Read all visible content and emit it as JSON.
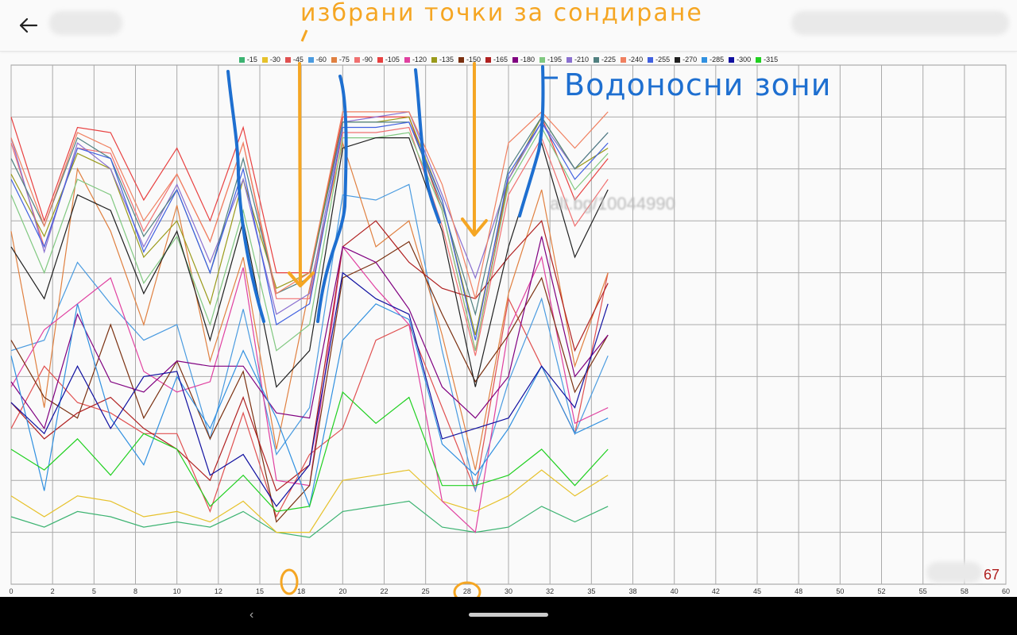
{
  "header": {
    "back_icon": "arrow-left-icon"
  },
  "chart_data": {
    "type": "line",
    "xlim": [
      0,
      60
    ],
    "x_ticks": [
      0,
      2,
      5,
      8,
      10,
      12,
      15,
      18,
      20,
      22,
      25,
      28,
      30,
      32,
      35,
      38,
      40,
      42,
      45,
      48,
      50,
      52,
      55,
      58,
      60
    ],
    "grid": true,
    "legend_position": "top-center",
    "x": [
      0,
      2,
      4,
      6,
      8,
      10,
      12,
      14,
      16,
      18,
      20,
      22,
      24,
      26,
      28,
      30,
      32,
      34,
      36
    ],
    "series": [
      {
        "name": "-15",
        "color": "#3cb371",
        "values": [
          0.87,
          0.89,
          0.86,
          0.87,
          0.89,
          0.88,
          0.89,
          0.86,
          0.9,
          0.91,
          0.86,
          0.85,
          0.84,
          0.89,
          0.9,
          0.89,
          0.85,
          0.88,
          0.85
        ]
      },
      {
        "name": "-30",
        "color": "#e6c12a",
        "values": [
          0.83,
          0.87,
          0.83,
          0.84,
          0.87,
          0.86,
          0.88,
          0.84,
          0.9,
          0.9,
          0.8,
          0.79,
          0.78,
          0.84,
          0.86,
          0.83,
          0.78,
          0.83,
          0.79
        ]
      },
      {
        "name": "-45",
        "color": "#e05050",
        "values": [
          0.7,
          0.58,
          0.65,
          0.67,
          0.71,
          0.71,
          0.86,
          0.67,
          0.87,
          0.75,
          0.7,
          0.53,
          0.5,
          0.66,
          0.82,
          0.45,
          0.58,
          0.71,
          0.4
        ]
      },
      {
        "name": "-60",
        "color": "#4a9be0",
        "values": [
          0.55,
          0.53,
          0.38,
          0.46,
          0.53,
          0.5,
          0.72,
          0.47,
          0.75,
          0.66,
          0.25,
          0.26,
          0.23,
          0.55,
          0.82,
          0.61,
          0.45,
          0.71,
          0.56
        ]
      },
      {
        "name": "-75",
        "color": "#e08040",
        "values": [
          0.32,
          0.66,
          0.2,
          0.32,
          0.5,
          0.27,
          0.57,
          0.37,
          0.74,
          0.43,
          0.15,
          0.35,
          0.3,
          0.52,
          0.78,
          0.44,
          0.24,
          0.58,
          0.4
        ]
      },
      {
        "name": "-90",
        "color": "#f07070",
        "values": [
          0.15,
          0.35,
          0.16,
          0.17,
          0.32,
          0.21,
          0.34,
          0.15,
          0.45,
          0.45,
          0.13,
          0.13,
          0.12,
          0.31,
          0.56,
          0.25,
          0.14,
          0.31,
          0.22
        ]
      },
      {
        "name": "-105",
        "color": "#e84040",
        "values": [
          0.1,
          0.3,
          0.12,
          0.13,
          0.26,
          0.16,
          0.3,
          0.12,
          0.4,
          0.4,
          0.1,
          0.1,
          0.1,
          0.28,
          0.55,
          0.22,
          0.1,
          0.26,
          0.18
        ]
      },
      {
        "name": "-120",
        "color": "#e040a0",
        "values": [
          0.62,
          0.51,
          0.46,
          0.41,
          0.59,
          0.63,
          0.61,
          0.39,
          0.8,
          0.81,
          0.35,
          0.43,
          0.5,
          0.84,
          0.9,
          0.51,
          0.37,
          0.69,
          0.66
        ]
      },
      {
        "name": "-135",
        "color": "#9a9a1a",
        "values": [
          0.21,
          0.33,
          0.17,
          0.2,
          0.37,
          0.3,
          0.46,
          0.22,
          0.43,
          0.4,
          0.11,
          0.11,
          0.1,
          0.26,
          0.52,
          0.22,
          0.1,
          0.2,
          0.16
        ]
      },
      {
        "name": "-150",
        "color": "#7a3010",
        "values": [
          0.53,
          0.64,
          0.68,
          0.5,
          0.68,
          0.57,
          0.72,
          0.59,
          0.88,
          0.81,
          0.41,
          0.38,
          0.34,
          0.48,
          0.61,
          0.52,
          0.41,
          0.63,
          0.52
        ]
      },
      {
        "name": "-165",
        "color": "#b02020",
        "values": [
          0.65,
          0.72,
          0.67,
          0.64,
          0.7,
          0.74,
          0.8,
          0.64,
          0.82,
          0.77,
          0.35,
          0.3,
          0.38,
          0.43,
          0.45,
          0.37,
          0.3,
          0.55,
          0.42
        ]
      },
      {
        "name": "-180",
        "color": "#800080",
        "values": [
          0.61,
          0.7,
          0.48,
          0.61,
          0.63,
          0.57,
          0.58,
          0.58,
          0.67,
          0.68,
          0.35,
          0.38,
          0.47,
          0.62,
          0.68,
          0.6,
          0.33,
          0.6,
          0.52
        ]
      },
      {
        "name": "-195",
        "color": "#80c880",
        "values": [
          0.25,
          0.4,
          0.22,
          0.25,
          0.42,
          0.33,
          0.5,
          0.28,
          0.55,
          0.5,
          0.14,
          0.14,
          0.13,
          0.28,
          0.55,
          0.23,
          0.12,
          0.24,
          0.17
        ]
      },
      {
        "name": "-210",
        "color": "#8a70d0",
        "values": [
          0.14,
          0.36,
          0.15,
          0.2,
          0.35,
          0.23,
          0.38,
          0.22,
          0.48,
          0.44,
          0.11,
          0.1,
          0.09,
          0.25,
          0.41,
          0.22,
          0.11,
          0.2,
          0.13
        ]
      },
      {
        "name": "-225",
        "color": "#508080",
        "values": [
          0.18,
          0.31,
          0.14,
          0.18,
          0.33,
          0.24,
          0.4,
          0.18,
          0.44,
          0.41,
          0.11,
          0.11,
          0.11,
          0.27,
          0.48,
          0.2,
          0.1,
          0.2,
          0.13
        ]
      },
      {
        "name": "-240",
        "color": "#f08060",
        "values": [
          0.14,
          0.31,
          0.13,
          0.16,
          0.3,
          0.21,
          0.34,
          0.15,
          0.44,
          0.4,
          0.09,
          0.09,
          0.09,
          0.23,
          0.45,
          0.15,
          0.09,
          0.16,
          0.09
        ]
      },
      {
        "name": "-255",
        "color": "#4060e0",
        "values": [
          0.22,
          0.35,
          0.16,
          0.18,
          0.36,
          0.24,
          0.4,
          0.2,
          0.5,
          0.46,
          0.12,
          0.12,
          0.11,
          0.26,
          0.53,
          0.21,
          0.11,
          0.22,
          0.15
        ]
      },
      {
        "name": "-270",
        "color": "#202020",
        "values": [
          0.35,
          0.45,
          0.25,
          0.28,
          0.44,
          0.32,
          0.53,
          0.3,
          0.62,
          0.55,
          0.16,
          0.14,
          0.14,
          0.32,
          0.62,
          0.35,
          0.15,
          0.37,
          0.24
        ]
      },
      {
        "name": "-285",
        "color": "#3090e0",
        "values": [
          0.56,
          0.82,
          0.46,
          0.68,
          0.77,
          0.6,
          0.7,
          0.55,
          0.68,
          0.85,
          0.53,
          0.46,
          0.49,
          0.73,
          0.79,
          0.7,
          0.58,
          0.71,
          0.68
        ]
      },
      {
        "name": "-300",
        "color": "#1010a0",
        "values": [
          0.65,
          0.71,
          0.58,
          0.7,
          0.6,
          0.59,
          0.79,
          0.75,
          0.85,
          0.77,
          0.4,
          0.45,
          0.48,
          0.72,
          0.7,
          0.68,
          0.58,
          0.66,
          0.46
        ]
      },
      {
        "name": "-315",
        "color": "#20d020",
        "values": [
          0.74,
          0.78,
          0.72,
          0.79,
          0.71,
          0.74,
          0.85,
          0.79,
          0.86,
          0.85,
          0.63,
          0.69,
          0.64,
          0.81,
          0.81,
          0.79,
          0.74,
          0.81,
          0.74
        ]
      }
    ]
  },
  "annotations": {
    "top_text": "избрани точки за сондиране",
    "right_text": "Водоносни зони",
    "watermark": "alt.bg/10044990",
    "page_number": "67"
  },
  "nav": {
    "back_glyph": "‹"
  }
}
